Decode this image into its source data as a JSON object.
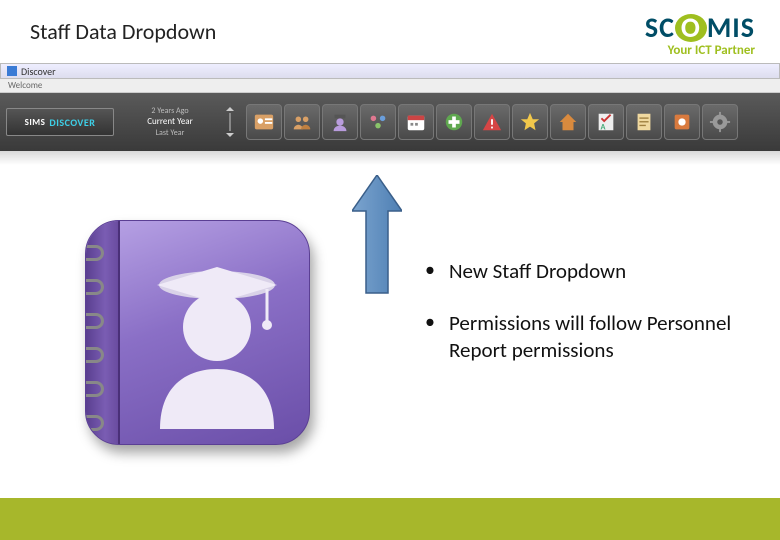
{
  "header": {
    "title": "Staff Data Dropdown",
    "logo_main_sc": "SC",
    "logo_main_o": "O",
    "logo_main_mis": "MIS",
    "logo_sub": "Your ICT Partner"
  },
  "app": {
    "window_title": "Discover",
    "welcome_tab": "Welcome",
    "brand_sims": "SIMS",
    "brand_discover": "DISCOVER",
    "year_prev": "2 Years Ago",
    "year_current": "Current Year",
    "year_last": "Last Year"
  },
  "toolbar_icons": [
    "student-card-icon",
    "group-icon",
    "staff-icon",
    "sen-icon",
    "calendar-icon",
    "add-icon",
    "alert-icon",
    "star-icon",
    "home-icon",
    "assessment-icon",
    "document-icon",
    "settings-icon",
    "gear-icon"
  ],
  "bullets": {
    "item1": "New Staff Dropdown",
    "item2": "Permissions will follow Personnel Report permissions"
  }
}
